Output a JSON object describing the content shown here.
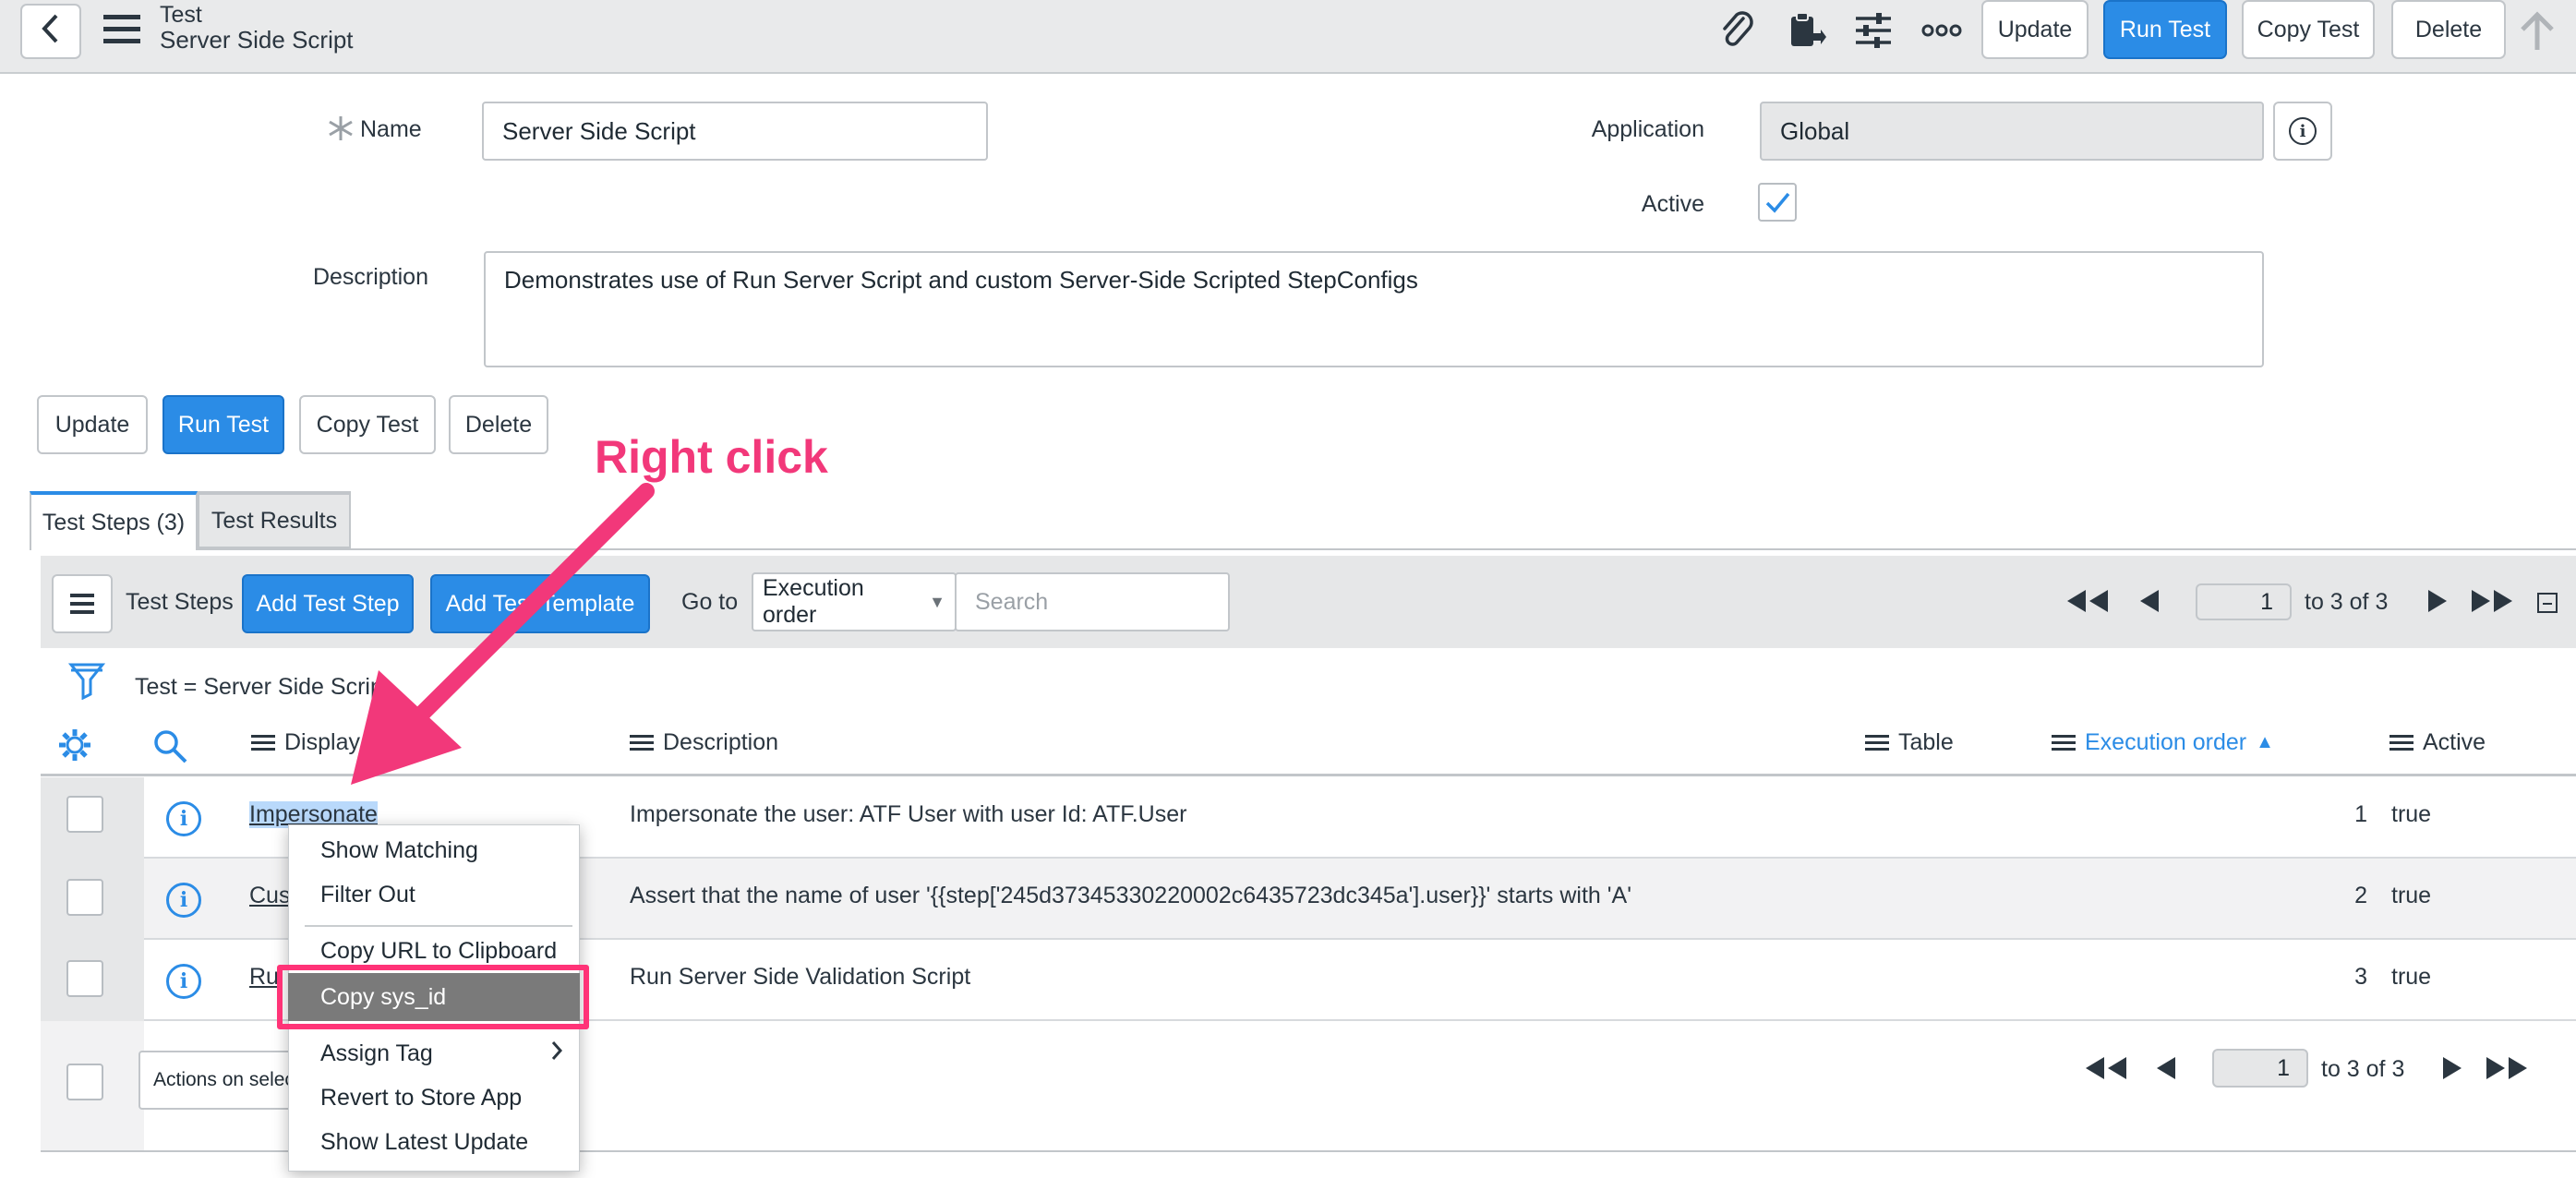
{
  "header": {
    "back_icon": "chevron-left-icon",
    "menu_icon": "hamburger-icon",
    "title": "Test",
    "subtitle": "Server Side Script",
    "icons": [
      "paperclip-icon",
      "clipboard-export-icon",
      "sliders-icon",
      "more-icon"
    ],
    "buttons": {
      "update": "Update",
      "run_test": "Run Test",
      "copy_test": "Copy Test",
      "delete": "Delete"
    },
    "up_icon": "arrow-up-icon"
  },
  "form": {
    "name_label": "Name",
    "name_value": "Server Side Script",
    "application_label": "Application",
    "application_value": "Global",
    "active_label": "Active",
    "active_checked": true,
    "description_label": "Description",
    "description_value": "Demonstrates use of Run Server Script and custom Server-Side Scripted StepConfigs",
    "buttons": {
      "update": "Update",
      "run_test": "Run Test",
      "copy_test": "Copy Test",
      "delete": "Delete"
    }
  },
  "annotation": {
    "text": "Right click"
  },
  "tabs": [
    {
      "label": "Test Steps (3)",
      "active": true
    },
    {
      "label": "Test Results",
      "active": false
    }
  ],
  "list": {
    "title": "Test Steps",
    "add_step_label": "Add Test Step",
    "add_template_label": "Add Test Template",
    "goto_label": "Go to",
    "goto_select": "Execution order",
    "search_placeholder": "Search",
    "page_value": "1",
    "page_range": "to 3 of 3",
    "filter_text": "Test = Server Side Script",
    "columns": {
      "display": "Display",
      "description": "Description",
      "table": "Table",
      "execution_order": "Execution order",
      "active": "Active"
    },
    "rows": [
      {
        "display": "Impersonate",
        "description": "Impersonate the user: ATF User with user Id: ATF.User",
        "order": "1",
        "active": "true"
      },
      {
        "display": "Cus",
        "description": "Assert that the name of user '{{step['245d37345330220002c6435723dc345a'].user}}' starts with 'A'",
        "order": "2",
        "active": "true"
      },
      {
        "display": "Ru",
        "description": "Run Server Side Validation Script",
        "order": "3",
        "active": "true"
      }
    ],
    "actions_placeholder": "Actions on selec",
    "footer_page_value": "1",
    "footer_page_range": "to 3 of 3"
  },
  "context_menu": {
    "items": [
      "Show Matching",
      "Filter Out",
      "Copy URL to Clipboard",
      "Copy sys_id",
      "Assign Tag",
      "Revert to Store App",
      "Show Latest Update"
    ],
    "highlighted_index": 3
  },
  "colors": {
    "accent": "#2b8ce6",
    "annotation": "#f2387a",
    "menu_highlight": "#7a7a7a"
  }
}
